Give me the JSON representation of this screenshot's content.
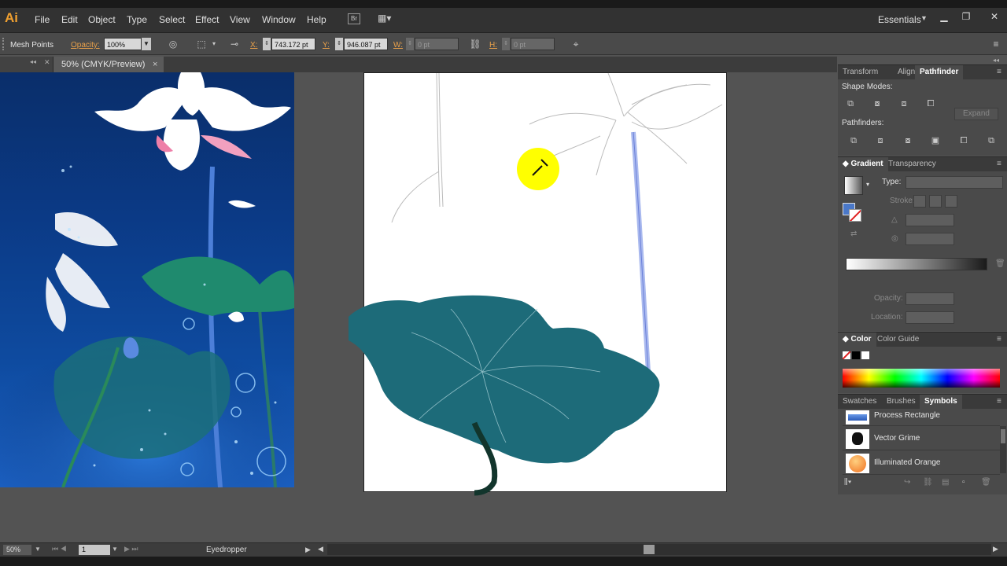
{
  "app": {
    "logo": "Ai"
  },
  "menu": [
    "File",
    "Edit",
    "Object",
    "Type",
    "Select",
    "Effect",
    "View",
    "Window",
    "Help"
  ],
  "bridge_label": "Br",
  "workspace": "Essentials",
  "control": {
    "selection": "Mesh Points",
    "opacity_label": "Opacity:",
    "opacity_value": "100%",
    "x_label": "X:",
    "x_value": "743.172 pt",
    "y_label": "Y:",
    "y_value": "946.087 pt",
    "w_label": "W:",
    "w_value": "0 pt",
    "h_label": "H:",
    "h_value": "0 pt"
  },
  "document": {
    "tab": "50% (CMYK/Preview)",
    "close": "×"
  },
  "panels": {
    "pathfinder": {
      "tabs": [
        "Transform",
        "Align",
        "Pathfinder"
      ],
      "shape_modes": "Shape Modes:",
      "pathfinders": "Pathfinders:",
      "expand": "Expand"
    },
    "gradient": {
      "tabs": [
        "Gradient",
        "Transparency"
      ],
      "type": "Type:",
      "stroke": "Stroke:",
      "opacity": "Opacity:",
      "location": "Location:"
    },
    "color": {
      "tabs": [
        "Color",
        "Color Guide"
      ]
    },
    "symbols": {
      "tabs": [
        "Swatches",
        "Brushes",
        "Symbols"
      ],
      "items": [
        "Process Rectangle",
        "Vector Grime",
        "Illuminated Orange"
      ]
    }
  },
  "status": {
    "zoom": "50%",
    "page": "1",
    "tool": "Eyedropper"
  },
  "colors": {
    "fill": "#4a78c8",
    "accent": "#f0a030",
    "leaf": "#1e6878",
    "highlight": "#ffff00"
  }
}
